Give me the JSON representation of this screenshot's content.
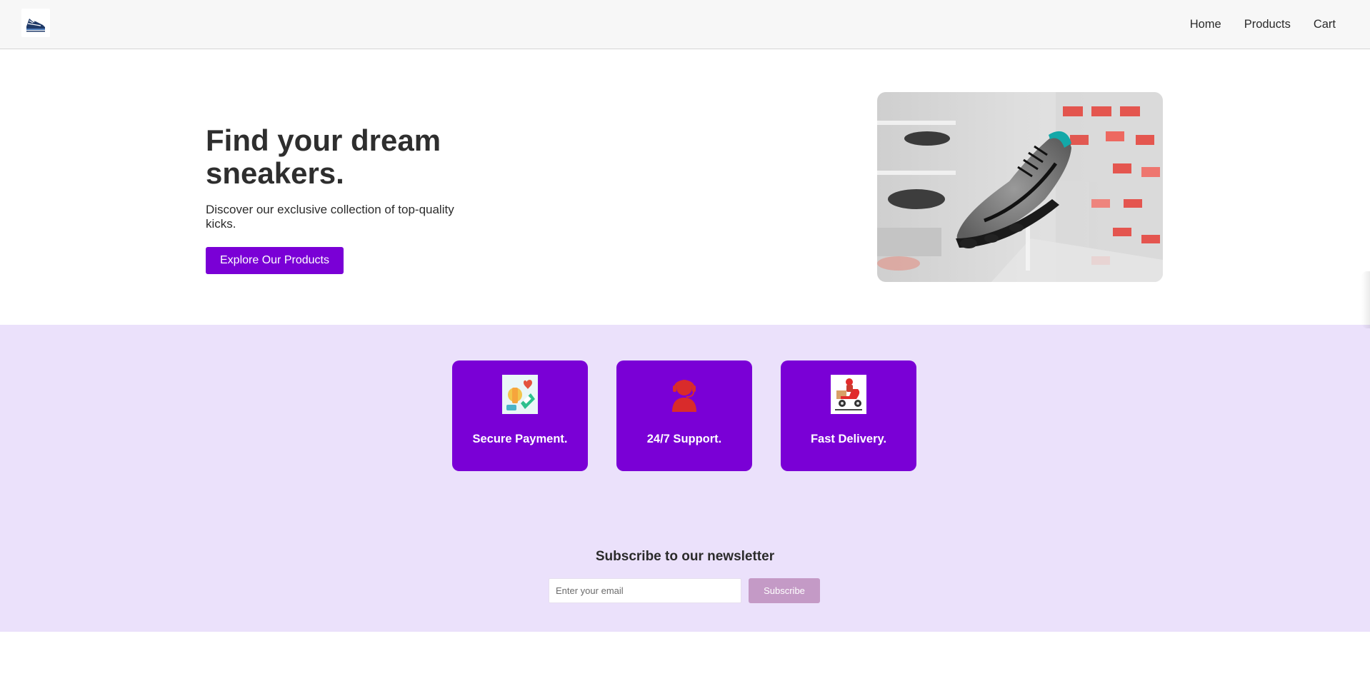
{
  "nav": {
    "logo_icon": "sneaker-logo-icon",
    "links": [
      "Home",
      "Products",
      "Cart"
    ]
  },
  "hero": {
    "title": "Find your dream sneakers.",
    "subtitle": "Discover our exclusive collection of top-quality kicks.",
    "cta_label": "Explore Our Products",
    "image": "sneaker-on-display-photo"
  },
  "features": [
    {
      "icon": "secure-payment-icon",
      "label": "Secure Payment."
    },
    {
      "icon": "support-headset-icon",
      "label": "24/7 Support."
    },
    {
      "icon": "delivery-scooter-icon",
      "label": "Fast Delivery."
    }
  ],
  "newsletter": {
    "title": "Subscribe to our newsletter",
    "email_placeholder": "Enter your email",
    "subscribe_label": "Subscribe"
  },
  "colors": {
    "accent": "#7a00d6",
    "band_background": "#ebe1fb",
    "subscribe_button": "#c49ac6",
    "navbar_background": "#f7f7f7"
  }
}
